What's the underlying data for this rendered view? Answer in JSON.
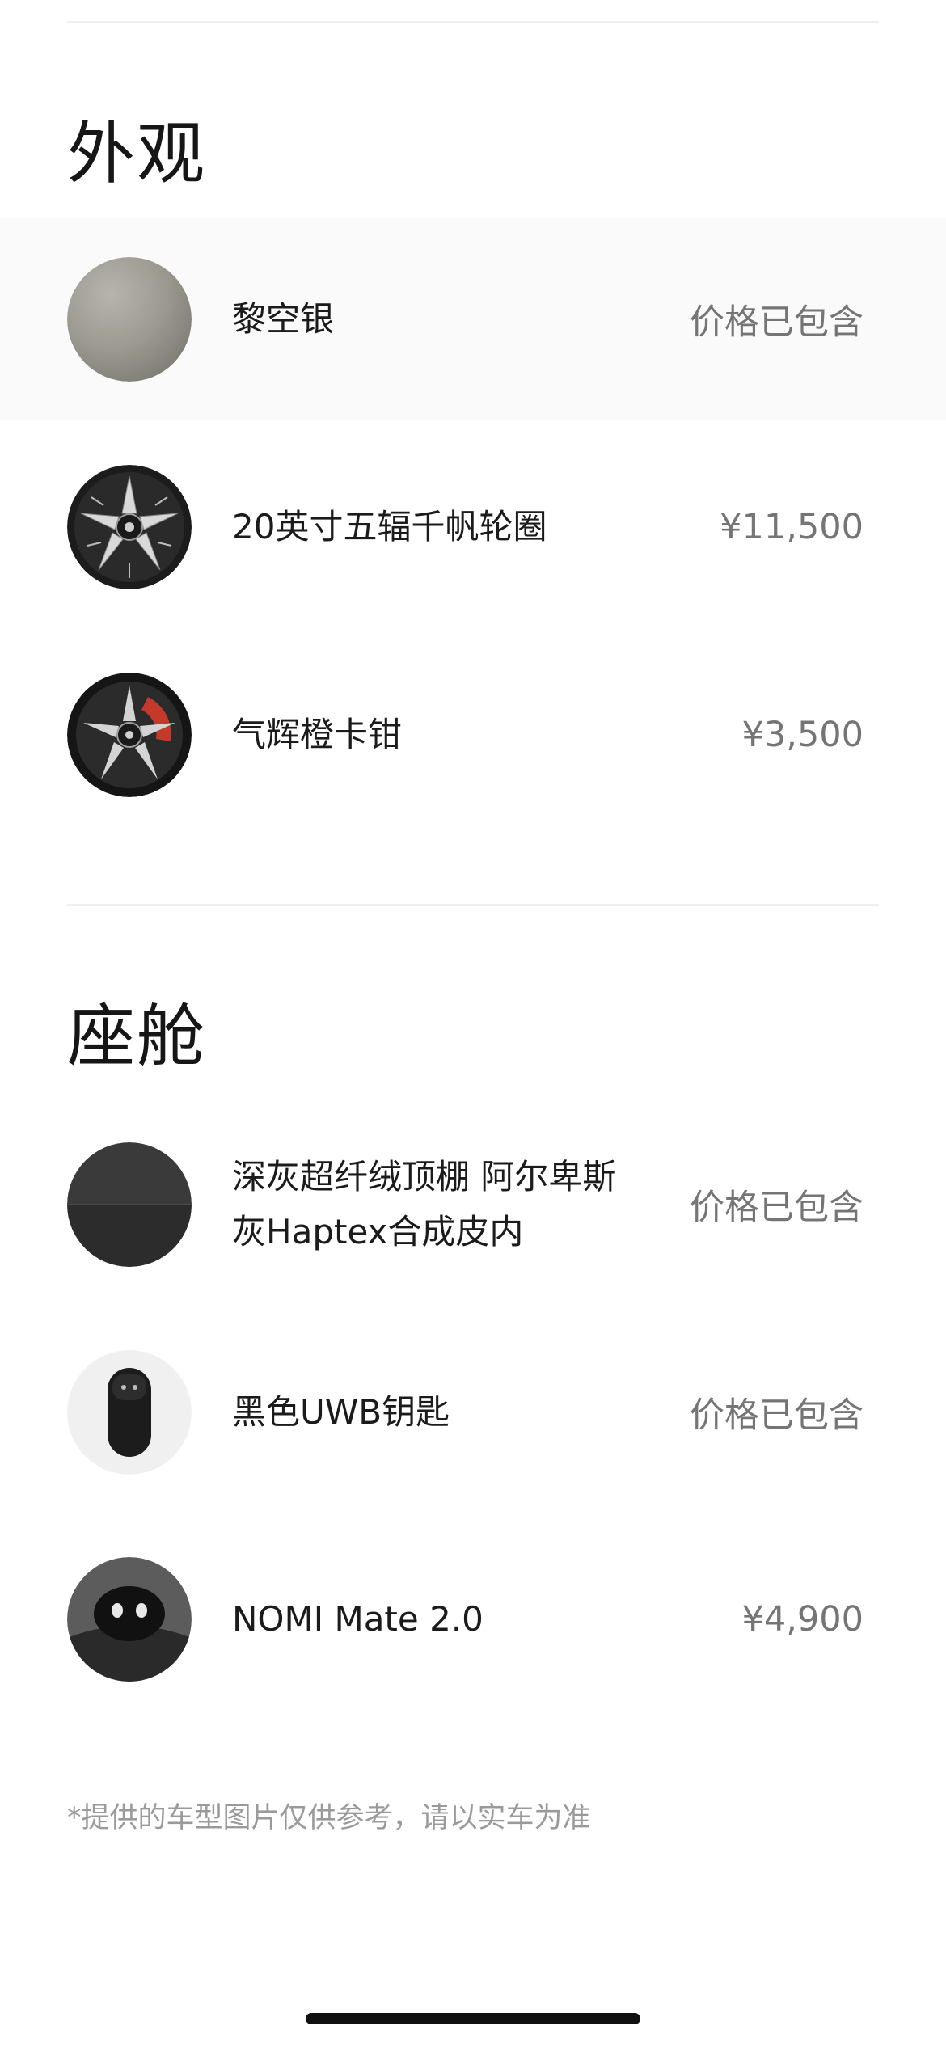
{
  "exterior": {
    "title": "外观",
    "items": [
      {
        "name": "黎空银",
        "price": "价格已包含",
        "icon": "paint-swatch-silver"
      },
      {
        "name": "20英寸五辐千帆轮圈",
        "price": "¥11,500",
        "icon": "wheel-rim"
      },
      {
        "name": "气辉橙卡钳",
        "price": "¥3,500",
        "icon": "brake-caliper-wheel"
      }
    ]
  },
  "cabin": {
    "title": "座舱",
    "items": [
      {
        "name": "深灰超纤绒顶棚 阿尔卑斯灰Haptex合成皮内",
        "price": "价格已包含",
        "icon": "interior-fabric-swatch"
      },
      {
        "name": "黑色UWB钥匙",
        "price": "价格已包含",
        "icon": "uwb-key-fob"
      },
      {
        "name": "NOMI Mate 2.0",
        "price": "¥4,900",
        "icon": "nomi-mate-device"
      }
    ]
  },
  "footer": {
    "disclaimer": "*提供的车型图片仅供参考，请以实车为准"
  },
  "colors": {
    "title": "#161616",
    "text": "#1b1b1b",
    "price": "#757575",
    "disclaimer": "#9a9a9a",
    "divider": "#efefef",
    "highlight_row": "#fafafa"
  }
}
